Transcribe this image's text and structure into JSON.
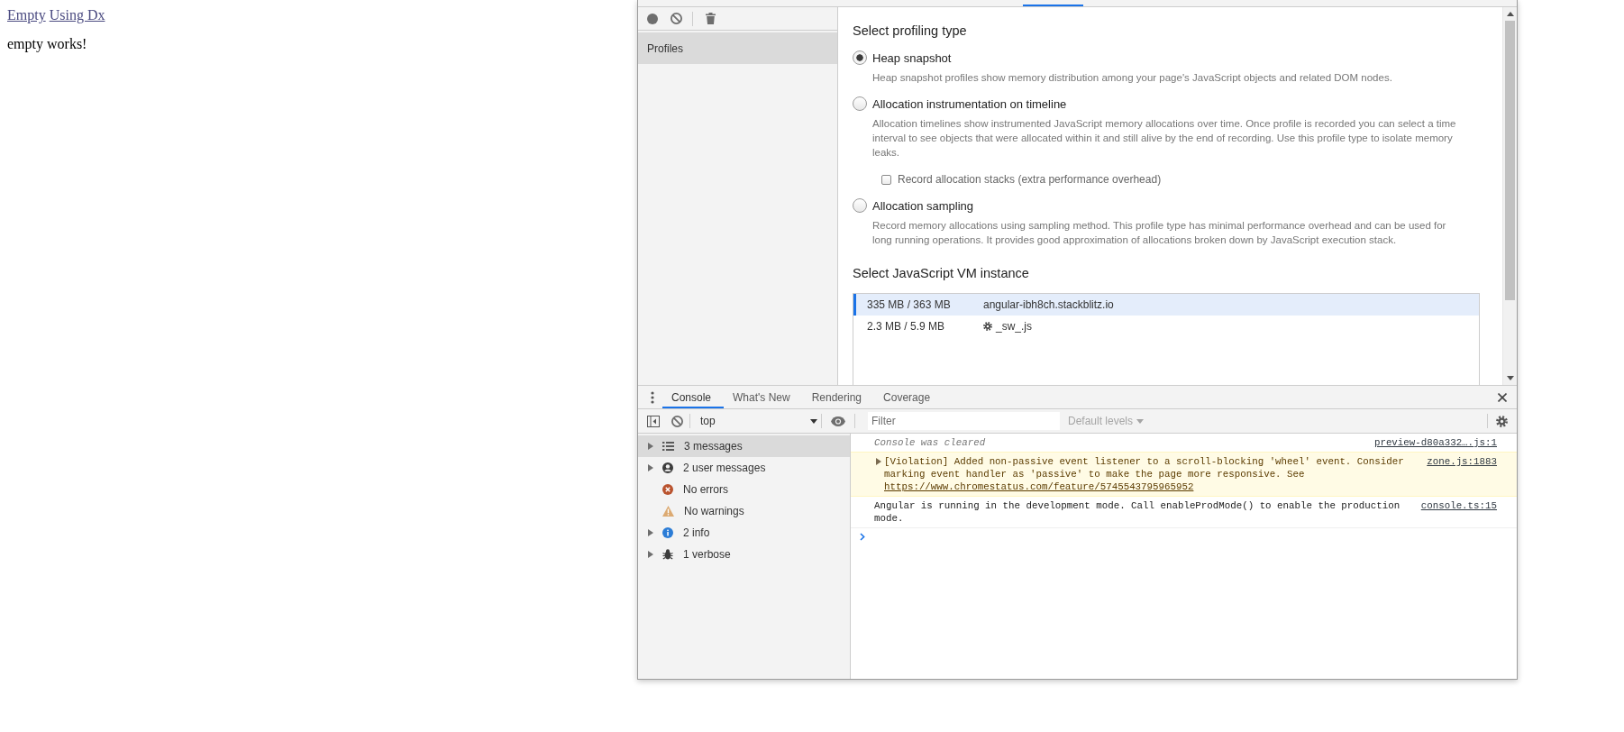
{
  "page": {
    "links": [
      "Empty",
      "Using Dx"
    ],
    "message": "empty works!"
  },
  "profiles_panel": {
    "sidebar_items": [
      {
        "label": "Profiles",
        "selected": true
      }
    ],
    "profiling_type_title": "Select profiling type",
    "profiling_types": [
      {
        "label": "Heap snapshot",
        "selected": true,
        "description": "Heap snapshot profiles show memory distribution among your page's JavaScript objects and related DOM nodes."
      },
      {
        "label": "Allocation instrumentation on timeline",
        "selected": false,
        "description": "Allocation timelines show instrumented JavaScript memory allocations over time. Once profile is recorded you can select a time interval to see objects that were allocated within it and still alive by the end of recording. Use this profile type to isolate memory leaks.",
        "checkbox": {
          "label": "Record allocation stacks (extra performance overhead)",
          "checked": false
        }
      },
      {
        "label": "Allocation sampling",
        "selected": false,
        "description": "Record memory allocations using sampling method. This profile type has minimal performance overhead and can be used for long running operations. It provides good approximation of allocations broken down by JavaScript execution stack."
      }
    ],
    "vm_instance_title": "Select JavaScript VM instance",
    "vm_instances": [
      {
        "memory": "335 MB / 363 MB",
        "target": "angular-ibh8ch.stackblitz.io",
        "kind": "page",
        "selected": true
      },
      {
        "memory": "2.3 MB / 5.9 MB",
        "target": "_sw_.js",
        "kind": "worker",
        "selected": false
      }
    ]
  },
  "console_drawer": {
    "tabs": [
      {
        "label": "Console",
        "selected": true
      },
      {
        "label": "What's New",
        "selected": false
      },
      {
        "label": "Rendering",
        "selected": false
      },
      {
        "label": "Coverage",
        "selected": false
      }
    ],
    "context": "top",
    "filter_placeholder": "Filter",
    "levels": {
      "label": "Default levels",
      "disabled": true
    },
    "sidebar_items": [
      {
        "kind": "all",
        "label": "3 messages",
        "expandable": true,
        "selected": true
      },
      {
        "kind": "user",
        "label": "2 user messages",
        "expandable": true,
        "selected": false
      },
      {
        "kind": "error",
        "label": "No errors",
        "expandable": false,
        "selected": false
      },
      {
        "kind": "warning",
        "label": "No warnings",
        "expandable": false,
        "selected": false
      },
      {
        "kind": "info",
        "label": "2 info",
        "expandable": true,
        "selected": false
      },
      {
        "kind": "verbose",
        "label": "1 verbose",
        "expandable": true,
        "selected": false
      }
    ],
    "messages": [
      {
        "kind": "cleared",
        "text": "Console was cleared",
        "source": "preview-d80a332….js:1"
      },
      {
        "kind": "violation",
        "text": "[Violation] Added non-passive event listener to a scroll-blocking 'wheel' event. Consider marking event handler as 'passive' to make the page more responsive. See",
        "link": "https://www.chromestatus.com/feature/5745543795965952",
        "source": "zone.js:1883"
      },
      {
        "kind": "log",
        "text": "Angular is running in the development mode. Call enableProdMode() to enable the production mode.",
        "source": "console.ts:15"
      }
    ]
  }
}
